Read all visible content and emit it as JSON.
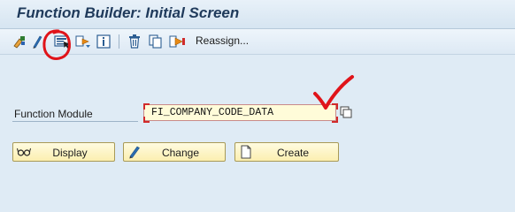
{
  "window": {
    "title": "Function Builder: Initial Screen"
  },
  "toolbar": {
    "icons": [
      "other-object-icon",
      "change-icon",
      "display-icon",
      "test-execute-icon",
      "info-icon",
      "delete-icon",
      "copy-icon",
      "rename-icon"
    ],
    "reassign_label": "Reassign..."
  },
  "form": {
    "function_module_label": "Function Module",
    "function_module_value": "FI_COMPANY_CODE_DATA"
  },
  "buttons": {
    "display": "Display",
    "change": "Change",
    "create": "Create"
  },
  "colors": {
    "annotation": "#e0141a",
    "background": "#dfebf5",
    "title": "#1f3a5b"
  }
}
